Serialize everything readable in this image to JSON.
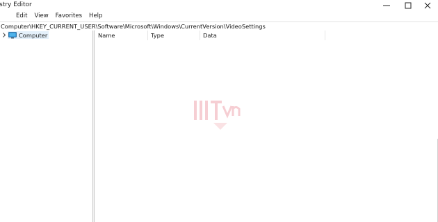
{
  "window": {
    "title": "stry Editor"
  },
  "controls": {
    "minimize_icon": "minimize-icon",
    "maximize_icon": "maximize-icon",
    "close_icon": "close-icon"
  },
  "menu": {
    "items": [
      {
        "label": "Edit"
      },
      {
        "label": "View"
      },
      {
        "label": "Favorites"
      },
      {
        "label": "Help"
      }
    ]
  },
  "address": {
    "path": "Computer\\HKEY_CURRENT_USER\\Software\\Microsoft\\Windows\\CurrentVersion\\VideoSettings"
  },
  "tree": {
    "root_label": "Computer",
    "root_icon": "computer-icon",
    "selection_color": "#e5f1fb"
  },
  "list": {
    "columns": [
      {
        "label": "Name"
      },
      {
        "label": "Type"
      },
      {
        "label": "Data"
      }
    ]
  },
  "watermark": {
    "text": "IIIT.vn",
    "color": "#d9263a"
  }
}
